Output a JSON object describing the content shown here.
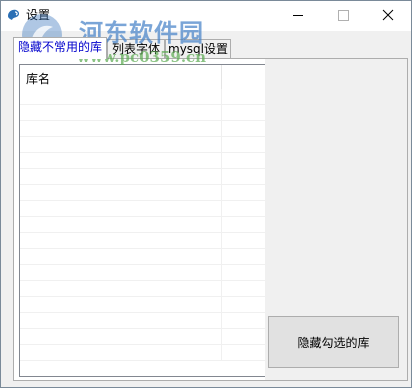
{
  "window": {
    "title": "设置",
    "controls": {
      "minimize": "minimize-icon",
      "maximize": "maximize-icon",
      "close": "close-icon"
    }
  },
  "watermark": {
    "line1": "河东软件园",
    "line2": "www.pc0359.cn"
  },
  "tabs": [
    {
      "label": "隐藏不常用的库",
      "active": true
    },
    {
      "label": "列表字体",
      "active": false
    },
    {
      "label": "mysql设置",
      "active": false
    }
  ],
  "library_list": {
    "columns": [
      "库名"
    ],
    "rows": []
  },
  "actions": {
    "hide_checked_label": "隐藏勾选的库"
  },
  "colors": {
    "active_tab_text": "#0000cc",
    "window_bg": "#f0f0f0",
    "button_bg": "#e1e1e1"
  }
}
